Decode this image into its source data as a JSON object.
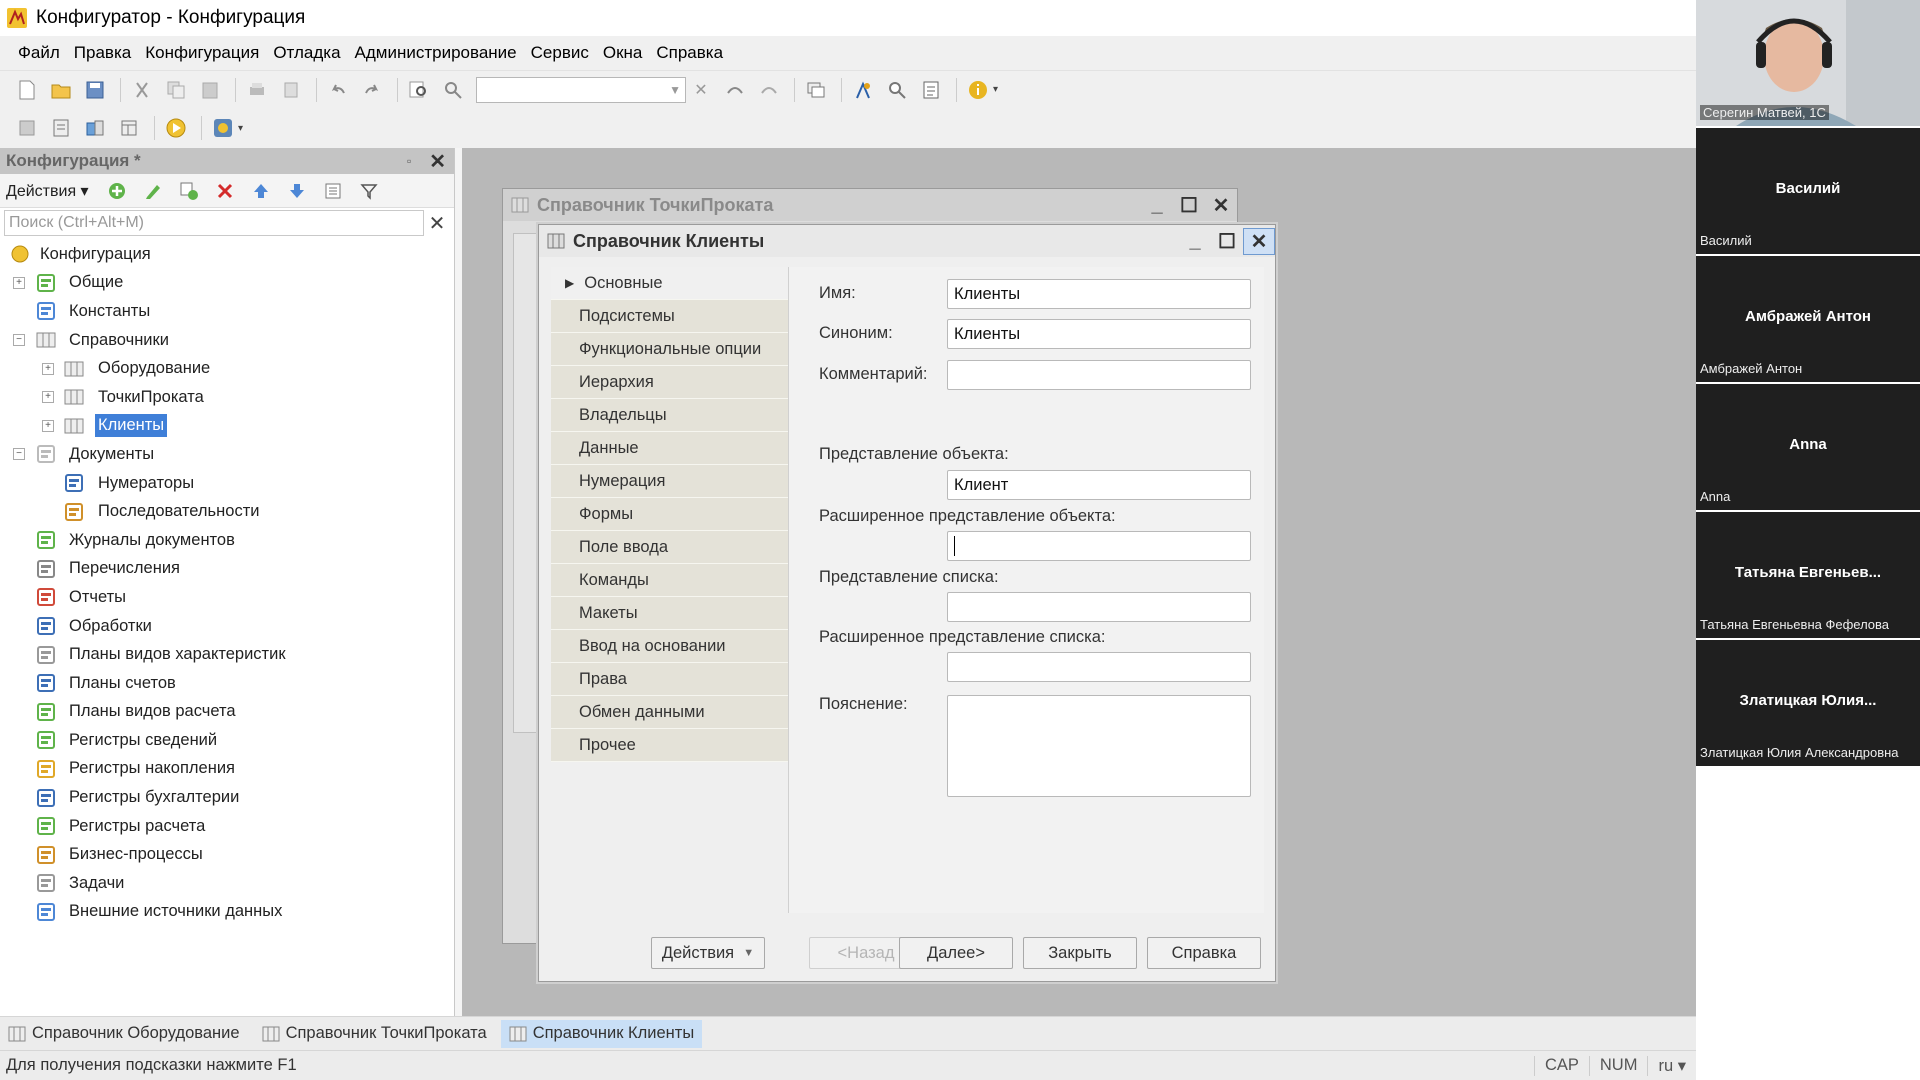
{
  "app": {
    "title": "Конфигуратор - Конфигурация"
  },
  "menu": [
    "Файл",
    "Правка",
    "Конфигурация",
    "Отладка",
    "Администрирование",
    "Сервис",
    "Окна",
    "Справка"
  ],
  "config_panel": {
    "title": "Конфигурация *",
    "actions_label": "Действия",
    "search_placeholder": "Поиск (Ctrl+Alt+M)",
    "tree": [
      {
        "label": "Конфигурация",
        "level": 0,
        "toggle": "",
        "icon": "config-icon"
      },
      {
        "label": "Общие",
        "level": 1,
        "toggle": "+",
        "icon": "common-icon"
      },
      {
        "label": "Константы",
        "level": 1,
        "toggle": "",
        "icon": "constants-icon"
      },
      {
        "label": "Справочники",
        "level": 1,
        "toggle": "−",
        "icon": "catalog-icon"
      },
      {
        "label": "Оборудование",
        "level": 2,
        "toggle": "+",
        "icon": "catalog-icon"
      },
      {
        "label": "ТочкиПроката",
        "level": 2,
        "toggle": "+",
        "icon": "catalog-icon"
      },
      {
        "label": "Клиенты",
        "level": 2,
        "toggle": "+",
        "icon": "catalog-icon",
        "selected": true
      },
      {
        "label": "Документы",
        "level": 1,
        "toggle": "−",
        "icon": "document-icon"
      },
      {
        "label": "Нумераторы",
        "level": 2,
        "toggle": "",
        "icon": "numerator-icon"
      },
      {
        "label": "Последовательности",
        "level": 2,
        "toggle": "",
        "icon": "sequence-icon"
      },
      {
        "label": "Журналы документов",
        "level": 1,
        "toggle": "",
        "icon": "journal-icon"
      },
      {
        "label": "Перечисления",
        "level": 1,
        "toggle": "",
        "icon": "enum-icon"
      },
      {
        "label": "Отчеты",
        "level": 1,
        "toggle": "",
        "icon": "report-icon"
      },
      {
        "label": "Обработки",
        "level": 1,
        "toggle": "",
        "icon": "processing-icon"
      },
      {
        "label": "Планы видов характеристик",
        "level": 1,
        "toggle": "",
        "icon": "chart-of-characteristics-icon"
      },
      {
        "label": "Планы счетов",
        "level": 1,
        "toggle": "",
        "icon": "chart-of-accounts-icon"
      },
      {
        "label": "Планы видов расчета",
        "level": 1,
        "toggle": "",
        "icon": "calculation-types-icon"
      },
      {
        "label": "Регистры сведений",
        "level": 1,
        "toggle": "",
        "icon": "info-register-icon"
      },
      {
        "label": "Регистры накопления",
        "level": 1,
        "toggle": "",
        "icon": "accumulation-register-icon"
      },
      {
        "label": "Регистры бухгалтерии",
        "level": 1,
        "toggle": "",
        "icon": "accounting-register-icon"
      },
      {
        "label": "Регистры расчета",
        "level": 1,
        "toggle": "",
        "icon": "calculation-register-icon"
      },
      {
        "label": "Бизнес-процессы",
        "level": 1,
        "toggle": "",
        "icon": "business-process-icon"
      },
      {
        "label": "Задачи",
        "level": 1,
        "toggle": "",
        "icon": "task-icon"
      },
      {
        "label": "Внешние источники данных",
        "level": 1,
        "toggle": "",
        "icon": "external-data-icon"
      }
    ]
  },
  "win_back": {
    "title": "Справочник ТочкиПроката"
  },
  "win_front": {
    "title": "Справочник Клиенты",
    "nav": [
      "Основные",
      "Подсистемы",
      "Функциональные опции",
      "Иерархия",
      "Владельцы",
      "Данные",
      "Нумерация",
      "Формы",
      "Поле ввода",
      "Команды",
      "Макеты",
      "Ввод на основании",
      "Права",
      "Обмен данными",
      "Прочее"
    ],
    "form": {
      "name_label": "Имя:",
      "name_value": "Клиенты",
      "synonym_label": "Синоним:",
      "synonym_value": "Клиенты",
      "comment_label": "Комментарий:",
      "comment_value": "",
      "obj_repr_label": "Представление объекта:",
      "obj_repr_value": "Клиент",
      "ext_obj_repr_label": "Расширенное представление объекта:",
      "ext_obj_repr_value": "",
      "list_repr_label": "Представление списка:",
      "list_repr_value": "",
      "ext_list_repr_label": "Расширенное представление списка:",
      "ext_list_repr_value": "",
      "explanation_label": "Пояснение:",
      "explanation_value": ""
    },
    "buttons": {
      "actions": "Действия",
      "back": "<Назад",
      "next": "Далее>",
      "close": "Закрыть",
      "help": "Справка"
    }
  },
  "taskbar": [
    "Справочник Оборудование",
    "Справочник ТочкиПроката",
    "Справочник Клиенты"
  ],
  "status": {
    "hint": "Для получения подсказки нажмите F1",
    "cap": "CAP",
    "num": "NUM",
    "lang": "ru ▾"
  },
  "participants": [
    {
      "display": "",
      "caption": "Серегин Матвей, 1С",
      "camera": true
    },
    {
      "display": "Василий",
      "caption": "Василий"
    },
    {
      "display": "Амбражей Антон",
      "caption": "Амбражей Антон"
    },
    {
      "display": "Anna",
      "caption": "Anna"
    },
    {
      "display": "Татьяна Евгеньев...",
      "caption": "Татьяна Евгеньевна Фефелова"
    },
    {
      "display": "Златицкая Юлия...",
      "caption": "Златицкая Юлия Александровна"
    }
  ],
  "colors": {
    "selection": "#3f7fd8",
    "nav_bg": "#e4e2d8",
    "mdi_bg": "#b8b8b8",
    "tile_bg": "#1f1f1f"
  }
}
